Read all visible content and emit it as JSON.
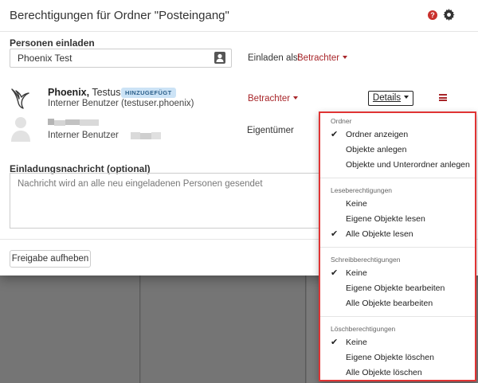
{
  "dialog": {
    "title": "Berechtigungen für Ordner \"Posteingang\"",
    "help_glyph": "?",
    "invite_label": "Personen einladen",
    "invite_value": "Phoenix Test",
    "invite_as_label": "Einladen als:",
    "invite_as_role": "Betrachter",
    "message_label": "Einladungsnachricht (optional)",
    "message_placeholder": "Nachricht wird an alle neu eingeladenen Personen gesendet",
    "unshare_label": "Freigabe aufheben"
  },
  "people": [
    {
      "name_bold": "Phoenix,",
      "name_rest": " Testuser",
      "badge": "HINZUGEFÜGT",
      "sub": "Interner Benutzer (testuser.phoenix)",
      "role": "Betrachter",
      "details_label": "Details"
    },
    {
      "sub": "Interner Benutzer",
      "role": "Eigentümer"
    }
  ],
  "menu": {
    "sections": [
      {
        "heading": "Ordner",
        "items": [
          {
            "label": "Ordner anzeigen",
            "checked": true
          },
          {
            "label": "Objekte anlegen",
            "checked": false
          },
          {
            "label": "Objekte und Unterordner anlegen",
            "checked": false
          }
        ]
      },
      {
        "heading": "Leseberechtigungen",
        "items": [
          {
            "label": "Keine",
            "checked": false
          },
          {
            "label": "Eigene Objekte lesen",
            "checked": false
          },
          {
            "label": "Alle Objekte lesen",
            "checked": true
          }
        ]
      },
      {
        "heading": "Schreibberechtigungen",
        "items": [
          {
            "label": "Keine",
            "checked": true
          },
          {
            "label": "Eigene Objekte bearbeiten",
            "checked": false
          },
          {
            "label": "Alle Objekte bearbeiten",
            "checked": false
          }
        ]
      },
      {
        "heading": "Löschberechtigungen",
        "items": [
          {
            "label": "Keine",
            "checked": true
          },
          {
            "label": "Eigene Objekte löschen",
            "checked": false
          },
          {
            "label": "Alle Objekte löschen",
            "checked": false
          }
        ]
      }
    ]
  },
  "colors": {
    "accent": "#a8262a",
    "badge_bg": "#cce3f6",
    "menu_highlight_border": "#e03434"
  },
  "icons": [
    "help-icon",
    "gear-icon",
    "contact-card-icon",
    "phoenix-logo-icon",
    "caret-down-icon",
    "hamburger-menu-icon",
    "user-avatar-icon",
    "check-icon"
  ]
}
